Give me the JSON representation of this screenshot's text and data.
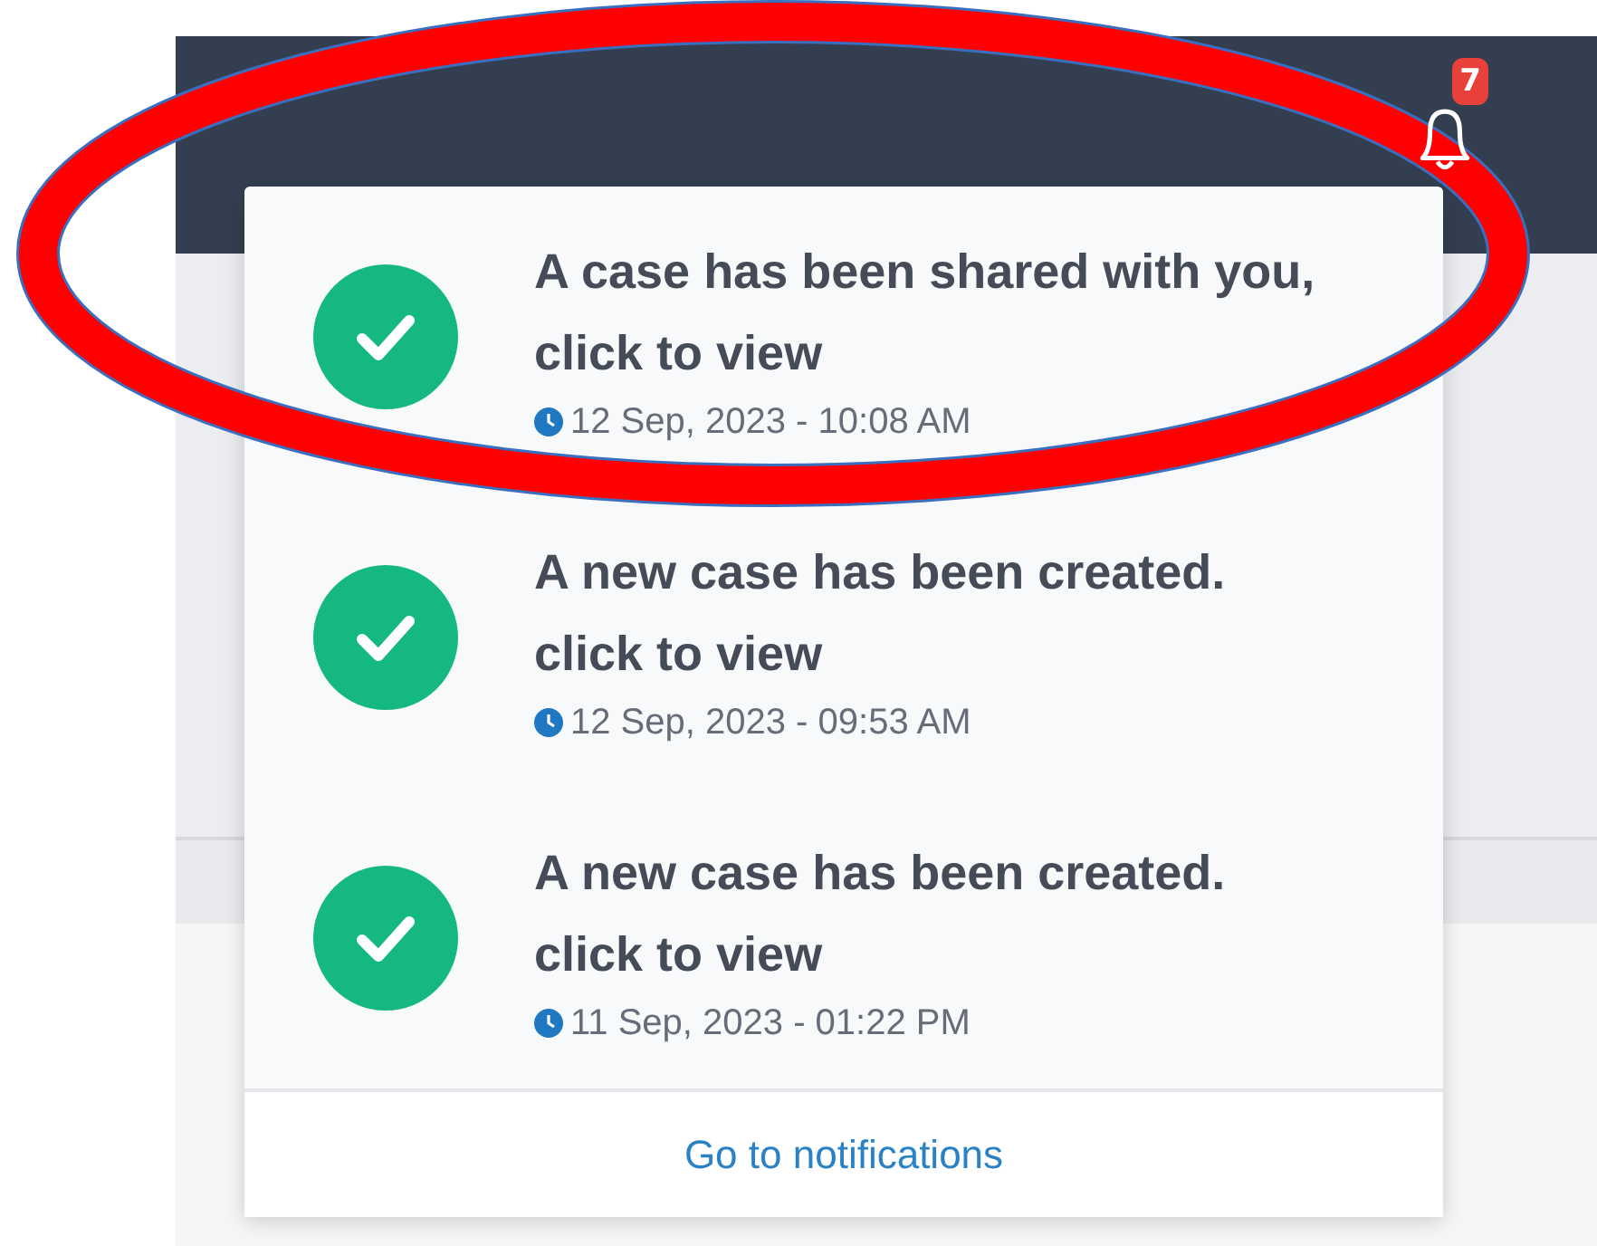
{
  "header": {
    "notification_count": "7"
  },
  "notifications": [
    {
      "title": "A case has been shared with you, click to view",
      "time": "12 Sep, 2023 - 10:08 AM"
    },
    {
      "title": "A new case has been created. click to view",
      "time": "12 Sep, 2023 - 09:53 AM"
    },
    {
      "title": "A new case has been created. click to view",
      "time": "11 Sep, 2023 - 01:22 PM"
    }
  ],
  "footer_link": "Go to notifications",
  "annotation": {
    "kind": "ellipse"
  }
}
